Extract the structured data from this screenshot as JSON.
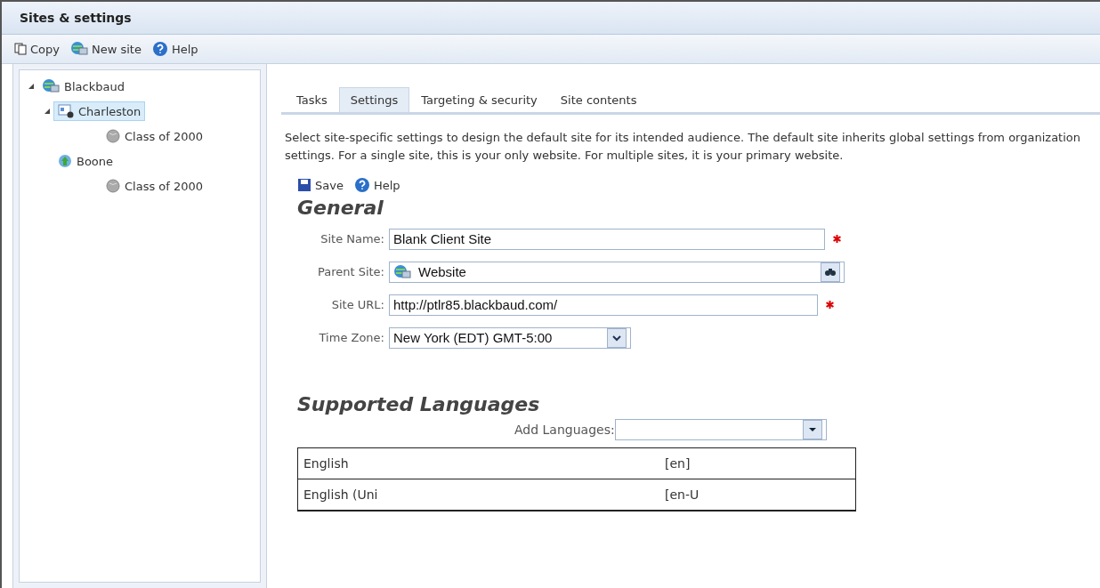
{
  "window": {
    "title": "Sites & settings"
  },
  "toolbar": [
    {
      "kind": "copy",
      "label": "Copy"
    },
    {
      "kind": "network",
      "label": "New site"
    },
    {
      "kind": "help",
      "label": "Help"
    }
  ],
  "tree": [
    {
      "label": "Blackbaud",
      "kind": "network",
      "expanded": true,
      "selected": false,
      "children": [
        {
          "label": "Charleston",
          "kind": "page",
          "expanded": true,
          "selected": true,
          "children": [
            {
              "label": "Class of 2000",
              "kind": "globe",
              "selected": false
            }
          ]
        },
        {
          "label": "Boone",
          "kind": "globe-up",
          "selected": false,
          "children": [
            {
              "label": "Class of 2000",
              "kind": "globe",
              "selected": false
            }
          ]
        }
      ]
    }
  ],
  "tabs": [
    {
      "label": "Tasks",
      "selected": false
    },
    {
      "label": "Settings",
      "selected": true
    },
    {
      "label": "Targeting & security",
      "selected": false
    },
    {
      "label": "Site contents",
      "selected": false
    }
  ],
  "description": "Select site-specific settings to design the default site for its intended audience. The default site inherits global settings from organization settings. For a single site, this is your only website. For multiple sites, it is your primary website.",
  "actions": [
    {
      "kind": "save",
      "label": "Save"
    },
    {
      "kind": "help",
      "label": "Help"
    }
  ],
  "general": {
    "heading": "General",
    "fields": [
      {
        "kind": "text",
        "label": "Site Name:",
        "value": "Blank Client Site",
        "required": true
      },
      {
        "kind": "lookup",
        "label": "Parent Site:",
        "value": "Website",
        "required": false
      },
      {
        "kind": "text",
        "label": "Site URL:",
        "value": "http://ptlr85.blackbaud.com/",
        "required": true
      },
      {
        "kind": "select",
        "label": "Time Zone:",
        "value": "New York (EDT) GMT-5:00",
        "required": false
      }
    ]
  },
  "languages": {
    "heading": "Supported Languages",
    "add_label": "Add Languages:",
    "rows": [
      {
        "name": "English",
        "code": "[en]"
      },
      {
        "name": "English (Uni",
        "code": "[en-U"
      }
    ]
  }
}
